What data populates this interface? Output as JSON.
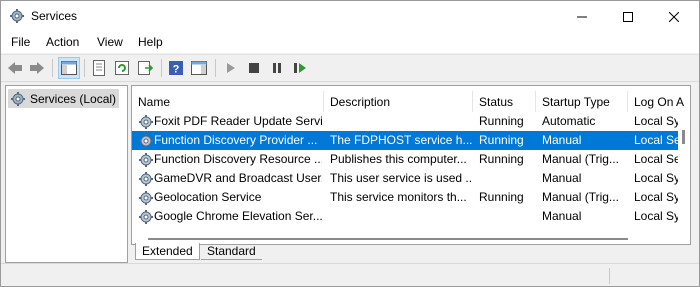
{
  "window": {
    "title": "Services"
  },
  "menu": [
    "File",
    "Action",
    "View",
    "Help"
  ],
  "tree": {
    "root_label": "Services (Local)"
  },
  "list": {
    "columns": [
      "Name",
      "Description",
      "Status",
      "Startup Type",
      "Log On A"
    ],
    "rows": [
      {
        "name": "Foxit PDF Reader Update Servi...",
        "description": "",
        "status": "Running",
        "startup": "Automatic",
        "logon": "Local Sy"
      },
      {
        "name": "Function Discovery Provider ...",
        "description": "The FDPHOST service h...",
        "status": "Running",
        "startup": "Manual",
        "logon": "Local Se"
      },
      {
        "name": "Function Discovery Resource ...",
        "description": "Publishes this computer...",
        "status": "Running",
        "startup": "Manual (Trig...",
        "logon": "Local Se"
      },
      {
        "name": "GameDVR and Broadcast User...",
        "description": "This user service is used ...",
        "status": "",
        "startup": "Manual",
        "logon": "Local Sy"
      },
      {
        "name": "Geolocation Service",
        "description": "This service monitors th...",
        "status": "Running",
        "startup": "Manual (Trig...",
        "logon": "Local Sy"
      },
      {
        "name": "Google Chrome Elevation Ser...",
        "description": "",
        "status": "",
        "startup": "Manual",
        "logon": "Local Sy"
      }
    ],
    "selected_index": 1
  },
  "tabs": [
    "Extended",
    "Standard"
  ],
  "colors": {
    "selection": "#0078d7",
    "header_bg": "#ffffff"
  }
}
